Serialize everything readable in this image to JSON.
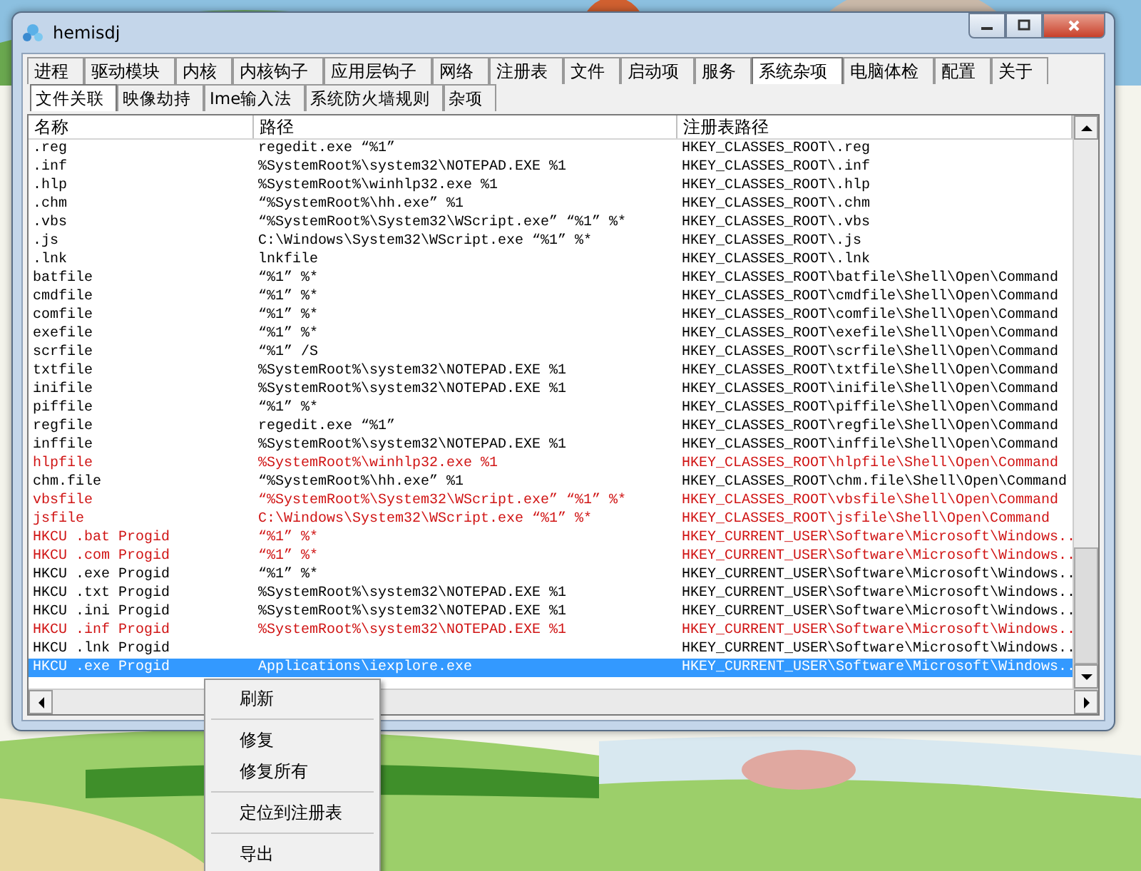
{
  "window": {
    "title": "hemisdj"
  },
  "tabs": [
    {
      "label": "进程",
      "selected": false
    },
    {
      "label": "驱动模块",
      "selected": false
    },
    {
      "label": "内核",
      "selected": false
    },
    {
      "label": "内核钩子",
      "selected": false
    },
    {
      "label": "应用层钩子",
      "selected": false
    },
    {
      "label": "网络",
      "selected": false
    },
    {
      "label": "注册表",
      "selected": false
    },
    {
      "label": "文件",
      "selected": false
    },
    {
      "label": "启动项",
      "selected": false
    },
    {
      "label": "服务",
      "selected": false
    },
    {
      "label": "系统杂项",
      "selected": true
    },
    {
      "label": "电脑体检",
      "selected": false
    },
    {
      "label": "配置",
      "selected": false
    },
    {
      "label": "关于",
      "selected": false
    }
  ],
  "subtabs": [
    {
      "label": "文件关联",
      "selected": true
    },
    {
      "label": "映像劫持",
      "selected": false
    },
    {
      "label": "Ime输入法",
      "selected": false
    },
    {
      "label": "系统防火墙规则",
      "selected": false
    },
    {
      "label": "杂项",
      "selected": false
    }
  ],
  "table": {
    "columns": [
      "名称",
      "路径",
      "注册表路径"
    ],
    "rows": [
      {
        "cells": [
          ".reg",
          "regedit.exe “%1”",
          "HKEY_CLASSES_ROOT\\.reg"
        ],
        "flagged": false,
        "selected": false
      },
      {
        "cells": [
          ".inf",
          "%SystemRoot%\\system32\\NOTEPAD.EXE %1",
          "HKEY_CLASSES_ROOT\\.inf"
        ],
        "flagged": false,
        "selected": false
      },
      {
        "cells": [
          ".hlp",
          "%SystemRoot%\\winhlp32.exe %1",
          "HKEY_CLASSES_ROOT\\.hlp"
        ],
        "flagged": false,
        "selected": false
      },
      {
        "cells": [
          ".chm",
          "“%SystemRoot%\\hh.exe” %1",
          "HKEY_CLASSES_ROOT\\.chm"
        ],
        "flagged": false,
        "selected": false
      },
      {
        "cells": [
          ".vbs",
          "“%SystemRoot%\\System32\\WScript.exe” “%1” %*",
          "HKEY_CLASSES_ROOT\\.vbs"
        ],
        "flagged": false,
        "selected": false
      },
      {
        "cells": [
          ".js",
          "C:\\Windows\\System32\\WScript.exe “%1” %*",
          "HKEY_CLASSES_ROOT\\.js"
        ],
        "flagged": false,
        "selected": false
      },
      {
        "cells": [
          ".lnk",
          "lnkfile",
          "HKEY_CLASSES_ROOT\\.lnk"
        ],
        "flagged": false,
        "selected": false
      },
      {
        "cells": [
          "batfile",
          "“%1” %*",
          "HKEY_CLASSES_ROOT\\batfile\\Shell\\Open\\Command"
        ],
        "flagged": false,
        "selected": false
      },
      {
        "cells": [
          "cmdfile",
          "“%1” %*",
          "HKEY_CLASSES_ROOT\\cmdfile\\Shell\\Open\\Command"
        ],
        "flagged": false,
        "selected": false
      },
      {
        "cells": [
          "comfile",
          "“%1” %*",
          "HKEY_CLASSES_ROOT\\comfile\\Shell\\Open\\Command"
        ],
        "flagged": false,
        "selected": false
      },
      {
        "cells": [
          "exefile",
          "“%1” %*",
          "HKEY_CLASSES_ROOT\\exefile\\Shell\\Open\\Command"
        ],
        "flagged": false,
        "selected": false
      },
      {
        "cells": [
          "scrfile",
          "“%1” /S",
          "HKEY_CLASSES_ROOT\\scrfile\\Shell\\Open\\Command"
        ],
        "flagged": false,
        "selected": false
      },
      {
        "cells": [
          "txtfile",
          "%SystemRoot%\\system32\\NOTEPAD.EXE %1",
          "HKEY_CLASSES_ROOT\\txtfile\\Shell\\Open\\Command"
        ],
        "flagged": false,
        "selected": false
      },
      {
        "cells": [
          "inifile",
          "%SystemRoot%\\system32\\NOTEPAD.EXE %1",
          "HKEY_CLASSES_ROOT\\inifile\\Shell\\Open\\Command"
        ],
        "flagged": false,
        "selected": false
      },
      {
        "cells": [
          "piffile",
          "“%1” %*",
          "HKEY_CLASSES_ROOT\\piffile\\Shell\\Open\\Command"
        ],
        "flagged": false,
        "selected": false
      },
      {
        "cells": [
          "regfile",
          "regedit.exe “%1”",
          "HKEY_CLASSES_ROOT\\regfile\\Shell\\Open\\Command"
        ],
        "flagged": false,
        "selected": false
      },
      {
        "cells": [
          "inffile",
          "%SystemRoot%\\system32\\NOTEPAD.EXE %1",
          "HKEY_CLASSES_ROOT\\inffile\\Shell\\Open\\Command"
        ],
        "flagged": false,
        "selected": false
      },
      {
        "cells": [
          "hlpfile",
          "%SystemRoot%\\winhlp32.exe %1",
          "HKEY_CLASSES_ROOT\\hlpfile\\Shell\\Open\\Command"
        ],
        "flagged": true,
        "selected": false
      },
      {
        "cells": [
          "chm.file",
          "“%SystemRoot%\\hh.exe” %1",
          "HKEY_CLASSES_ROOT\\chm.file\\Shell\\Open\\Command"
        ],
        "flagged": false,
        "selected": false
      },
      {
        "cells": [
          "vbsfile",
          "“%SystemRoot%\\System32\\WScript.exe” “%1” %*",
          "HKEY_CLASSES_ROOT\\vbsfile\\Shell\\Open\\Command"
        ],
        "flagged": true,
        "selected": false
      },
      {
        "cells": [
          "jsfile",
          "C:\\Windows\\System32\\WScript.exe “%1” %*",
          "HKEY_CLASSES_ROOT\\jsfile\\Shell\\Open\\Command"
        ],
        "flagged": true,
        "selected": false
      },
      {
        "cells": [
          "HKCU .bat Progid",
          "“%1” %*",
          "HKEY_CURRENT_USER\\Software\\Microsoft\\Windows.."
        ],
        "flagged": true,
        "selected": false
      },
      {
        "cells": [
          "HKCU .com Progid",
          "“%1” %*",
          "HKEY_CURRENT_USER\\Software\\Microsoft\\Windows.."
        ],
        "flagged": true,
        "selected": false
      },
      {
        "cells": [
          "HKCU .exe Progid",
          "“%1” %*",
          "HKEY_CURRENT_USER\\Software\\Microsoft\\Windows.."
        ],
        "flagged": false,
        "selected": false
      },
      {
        "cells": [
          "HKCU .txt Progid",
          "%SystemRoot%\\system32\\NOTEPAD.EXE %1",
          "HKEY_CURRENT_USER\\Software\\Microsoft\\Windows.."
        ],
        "flagged": false,
        "selected": false
      },
      {
        "cells": [
          "HKCU .ini Progid",
          "%SystemRoot%\\system32\\NOTEPAD.EXE %1",
          "HKEY_CURRENT_USER\\Software\\Microsoft\\Windows.."
        ],
        "flagged": false,
        "selected": false
      },
      {
        "cells": [
          "HKCU .inf Progid",
          "%SystemRoot%\\system32\\NOTEPAD.EXE %1",
          "HKEY_CURRENT_USER\\Software\\Microsoft\\Windows.."
        ],
        "flagged": true,
        "selected": false
      },
      {
        "cells": [
          "HKCU .lnk Progid",
          "",
          "HKEY_CURRENT_USER\\Software\\Microsoft\\Windows.."
        ],
        "flagged": false,
        "selected": false
      },
      {
        "cells": [
          "HKCU .exe Progid",
          "Applications\\iexplore.exe",
          "HKEY_CURRENT_USER\\Software\\Microsoft\\Windows.."
        ],
        "flagged": false,
        "selected": true
      }
    ]
  },
  "context_menu": {
    "groups": [
      [
        "刷新"
      ],
      [
        "修复",
        "修复所有"
      ],
      [
        "定位到注册表"
      ],
      [
        "导出"
      ]
    ]
  }
}
